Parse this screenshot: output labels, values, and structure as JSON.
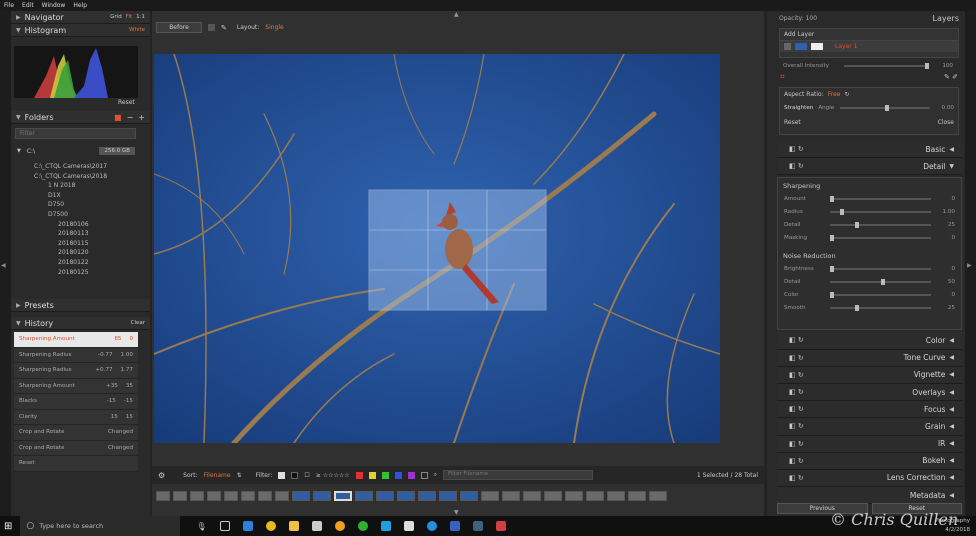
{
  "menu": [
    "File",
    "Edit",
    "Window",
    "Help"
  ],
  "navigator": {
    "title": "Navigator",
    "options": [
      "Grid",
      "Fit",
      "1:1"
    ]
  },
  "histogram": {
    "title": "Histogram",
    "option": "White",
    "reset": "Reset"
  },
  "folders": {
    "title": "Folders",
    "search_placeholder": "Filter",
    "drive": "C:\\",
    "drive_size": "256.0 GB",
    "items": [
      "C:\\_CTQL Cameras\\2017",
      "C:\\_CTQL Cameras\\2018",
      "1 N 2018",
      "D1X",
      "D750",
      "D7500",
      "20180106",
      "20180113",
      "20180115",
      "20180120",
      "20180122",
      "20180125"
    ]
  },
  "presets": {
    "title": "Presets"
  },
  "history": {
    "title": "History",
    "clear": "Clear",
    "rows": [
      {
        "name": "Sharpening Amount",
        "a": "85",
        "b": "0"
      },
      {
        "name": "Sharpening Radius",
        "a": "-0.77",
        "b": "1.00"
      },
      {
        "name": "Sharpening Radius",
        "a": "+0.77",
        "b": "1.77"
      },
      {
        "name": "Sharpening Amount",
        "a": "+35",
        "b": "35"
      },
      {
        "name": "Blacks",
        "a": "-15",
        "b": "-15"
      },
      {
        "name": "Clarity",
        "a": "15",
        "b": "15"
      },
      {
        "name": "Crop and Rotate",
        "a": "",
        "b": "Changed"
      },
      {
        "name": "Crop and Rotate",
        "a": "",
        "b": "Changed"
      },
      {
        "name": "Reset",
        "a": "",
        "b": ""
      }
    ]
  },
  "toolbar": {
    "before": "Before",
    "layout_label": "Layout:",
    "layout_value": "Single"
  },
  "bottom": {
    "sort_label": "Sort:",
    "sort_value": "Filename",
    "filter_label": "Filter:",
    "filter_placeholder": "Filter Filename",
    "count": "1 Selected / 28 Total"
  },
  "layers": {
    "opacity": "Opacity: 100",
    "title": "Layers",
    "add_layer": "Add Layer",
    "layer1": "Layer 1",
    "overall": "Overall Intensity",
    "overall_val": "100"
  },
  "crop": {
    "aspect": "Aspect Ratio:",
    "aspect_val": "Free",
    "straighten": "Straighten",
    "angle": "Angle",
    "angle_val": "0.00",
    "reset": "Reset",
    "close": "Close"
  },
  "sections": {
    "basic": "Basic",
    "detail": "Detail",
    "color": "Color",
    "tone": "Tone Curve",
    "vignette": "Vignette",
    "overlays": "Overlays",
    "focus": "Focus",
    "grain": "Grain",
    "ir": "IR",
    "bokeh": "Bokeh",
    "lens": "Lens Correction",
    "metadata": "Metadata"
  },
  "sharpening": {
    "title": "Sharpening",
    "rows": [
      {
        "l": "Amount",
        "v": "0"
      },
      {
        "l": "Radius",
        "v": "1.00"
      },
      {
        "l": "Detail",
        "v": "25"
      },
      {
        "l": "Masking",
        "v": "0"
      }
    ]
  },
  "noise": {
    "title": "Noise Reduction",
    "rows": [
      {
        "l": "Brightness",
        "v": "0"
      },
      {
        "l": "Detail",
        "v": "50"
      },
      {
        "l": "Color",
        "v": "0"
      },
      {
        "l": "Smooth",
        "v": "25"
      }
    ]
  },
  "nav_buttons": {
    "previous": "Previous",
    "reset": "Reset"
  },
  "taskbar": {
    "search": "Type here to search",
    "app": "Photography",
    "date": "4/2/2018",
    "watermark": "© Chris Quillen"
  }
}
